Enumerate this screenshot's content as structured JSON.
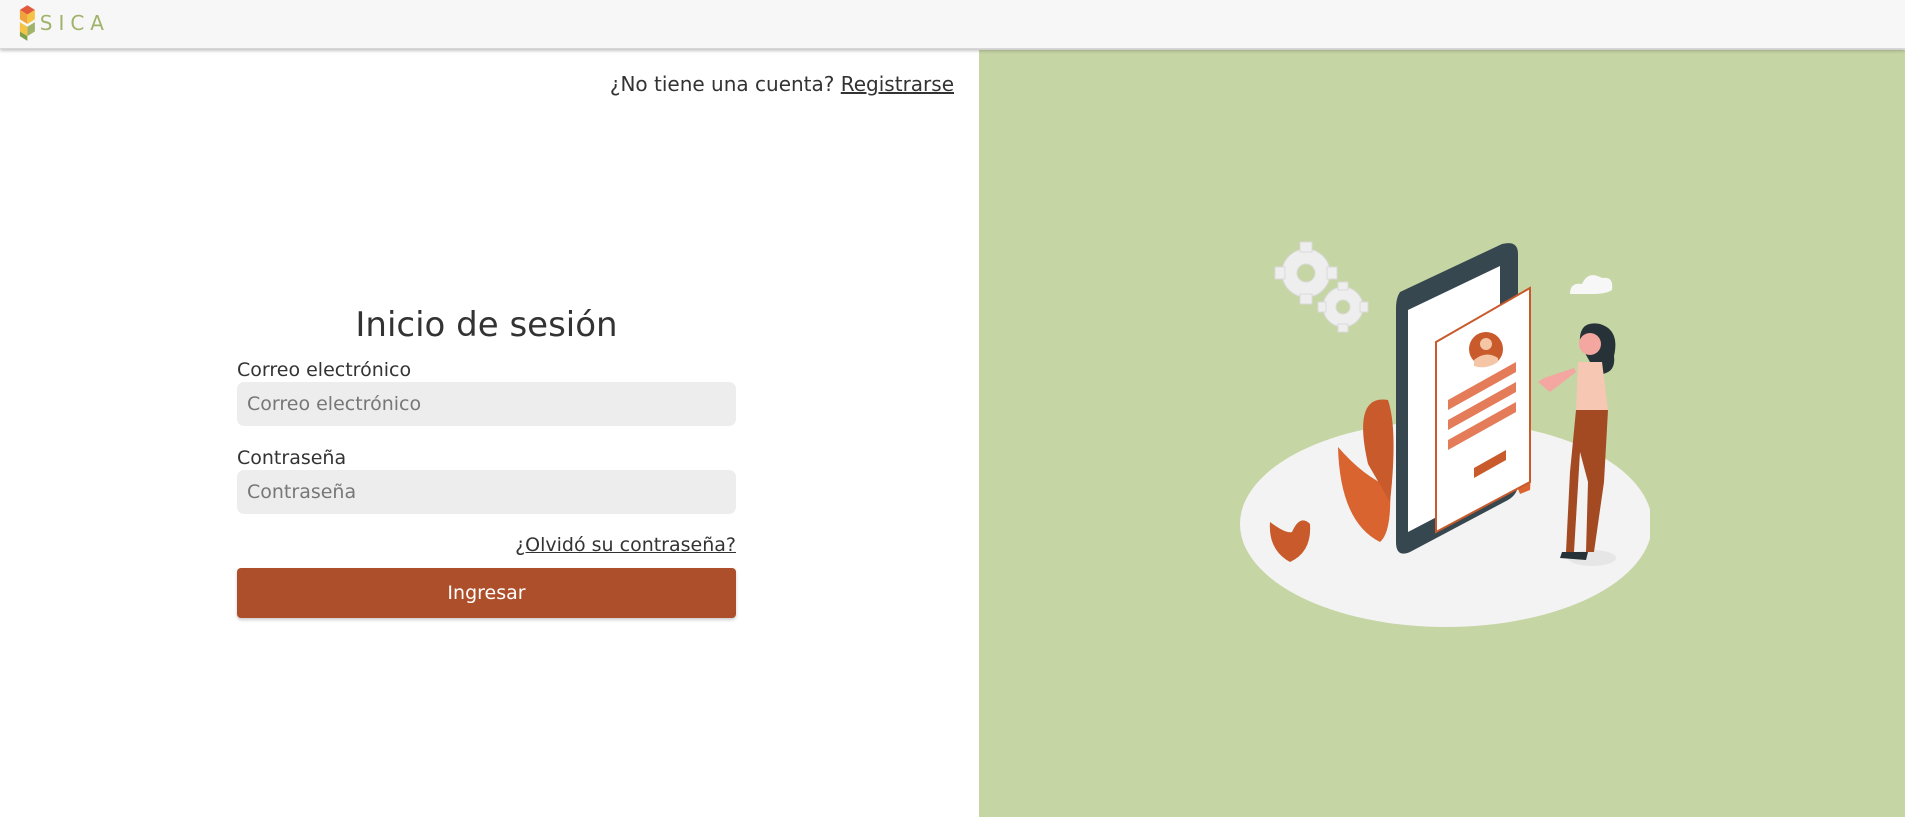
{
  "brand": {
    "name": "SICA",
    "logo_icon": "sica-cube-logo",
    "color": "#9fb36a"
  },
  "header": {
    "signup_prompt": "¿No tiene una cuenta?",
    "signup_link": "Registrarse"
  },
  "login": {
    "title": "Inicio de sesión",
    "email_label": "Correo electrónico",
    "email_placeholder": "Correo electrónico",
    "email_value": "",
    "password_label": "Contraseña",
    "password_placeholder": "Contraseña",
    "password_value": "",
    "forgot_link": "¿Olvidó su contraseña?",
    "submit_label": "Ingresar"
  },
  "colors": {
    "accent": "#ad4f2a",
    "panel_bg": "#c6d5a4",
    "input_bg": "#ededed",
    "header_bg": "#f7f7f7"
  },
  "illustration": {
    "icon": "mobile-profile-illustration"
  }
}
